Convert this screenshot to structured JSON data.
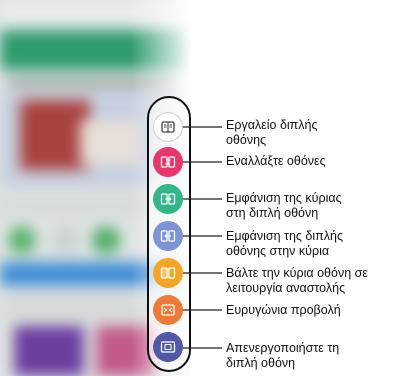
{
  "toolbar": {
    "items": [
      {
        "id": "dual-screen-tool",
        "label": "Εργαλείο διπλής\nοθόνης",
        "icon": "dual-screen-tool-icon",
        "color": "#ffffff"
      },
      {
        "id": "swap-screens",
        "label": "Εναλλάξτε οθόνες",
        "icon": "swap-screens-icon",
        "color": "#e8356a"
      },
      {
        "id": "show-main-on-dual",
        "label": "Εμφάνιση της κύριας\nστη διπλή οθόνη",
        "icon": "show-main-on-dual-icon",
        "color": "#33b58a"
      },
      {
        "id": "show-dual-on-main",
        "label": "Εμφάνιση της διπλής\nοθόνης στην κύρια",
        "icon": "show-dual-on-main-icon",
        "color": "#7d95d6"
      },
      {
        "id": "sleep-main",
        "label": "Βάλτε την κύρια οθόνη σε\nλειτουργία αναστολής",
        "icon": "sleep-main-icon",
        "color": "#f4a622"
      },
      {
        "id": "wide-view",
        "label": "Ευρυγώνια προβολή",
        "icon": "wide-view-icon",
        "color": "#ee7a38"
      },
      {
        "id": "disable-dual",
        "label": "Απενεργοποιήστε τη\nδιπλή οθόνη",
        "icon": "disable-dual-icon",
        "color": "#5158a8"
      }
    ]
  }
}
